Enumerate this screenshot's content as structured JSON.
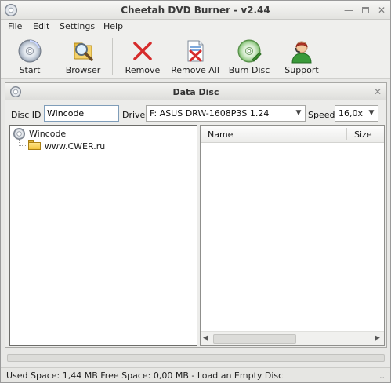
{
  "window": {
    "title": "Cheetah DVD Burner - v2.44"
  },
  "menu": {
    "items": [
      "File",
      "Edit",
      "Settings",
      "Help"
    ]
  },
  "toolbar": {
    "buttons": [
      {
        "label": "Start",
        "icon": "disc-icon"
      },
      {
        "label": "Browser",
        "icon": "magnifier-icon"
      },
      {
        "label": "Remove",
        "icon": "red-x-icon"
      },
      {
        "label": "Remove All",
        "icon": "remove-all-icon"
      },
      {
        "label": "Burn Disc",
        "icon": "burn-disc-icon"
      },
      {
        "label": "Support",
        "icon": "support-person-icon"
      }
    ]
  },
  "panel": {
    "title": "Data Disc",
    "disc_id_label": "Disc ID",
    "disc_id_value": "Wincode",
    "drive_label": "Drive",
    "drive_value": "F: ASUS DRW-1608P3S 1.24",
    "speed_label": "Speed",
    "speed_value": "16,0x"
  },
  "tree": {
    "root": "Wincode",
    "children": [
      "www.CWER.ru"
    ]
  },
  "list": {
    "columns": [
      "Name",
      "Size"
    ]
  },
  "progress": {
    "fraction": 0.0
  },
  "status": {
    "text": "Used Space: 1,44 MB   Free Space: 0,00 MB - Load an Empty Disc"
  },
  "colors": {
    "remove_red": "#d62b2b",
    "folder_yellow": "#f1c33d"
  }
}
